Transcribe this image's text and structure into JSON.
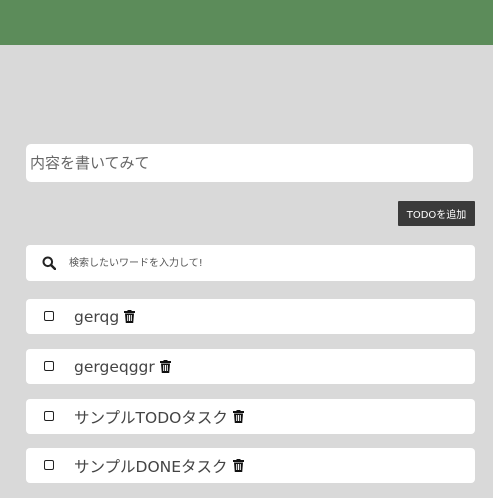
{
  "header": {
    "color": "#5c8c5a"
  },
  "todo_form": {
    "content_placeholder": "内容を書いてみて",
    "add_button_label": "TODOを追加"
  },
  "search": {
    "placeholder": "検索したいワードを入力して!",
    "icon": "search-icon"
  },
  "todos": [
    {
      "text": "gerqg",
      "checked": false
    },
    {
      "text": "gergeqggr",
      "checked": false
    },
    {
      "text": "サンプルTODOタスク",
      "checked": false
    },
    {
      "text": "サンプルDONEタスク",
      "checked": false
    }
  ]
}
